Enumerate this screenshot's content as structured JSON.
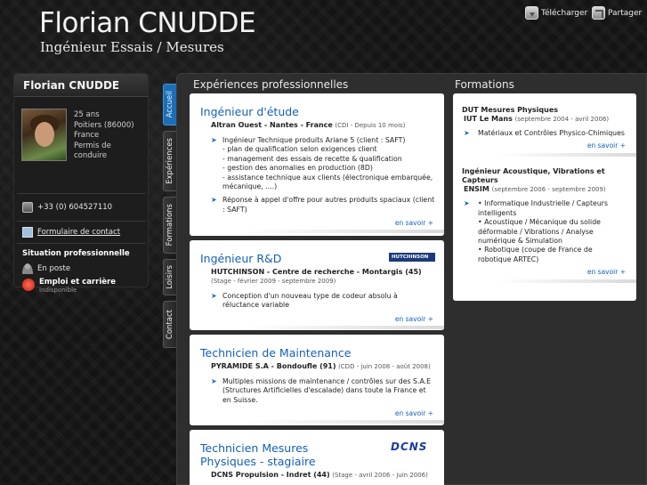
{
  "header": {
    "name": "Florian CNUDDE",
    "title": "Ingénieur Essais / Mesures",
    "download_label": "Télécharger",
    "share_label": "Partager"
  },
  "sidebar": {
    "name": "Florian CNUDDE",
    "profile": {
      "age": "25 ans",
      "city": "Poitiers (86000)",
      "country": "France",
      "license": "Permis de conduire"
    },
    "phone": "+33 (0) 604527110",
    "contact_form": "Formulaire de contact",
    "situation_title": "Situation professionnelle",
    "status": "En poste",
    "job_title": "Emploi et carrière",
    "job_status": "Indisponible"
  },
  "tabs": [
    "Accueil",
    "Expériences",
    "Formations",
    "Loisirs",
    "Contact"
  ],
  "experiences": {
    "title": "Expériences professionnelles",
    "more_label": "en savoir +",
    "items": [
      {
        "role": "Ingénieur d'étude",
        "company": "Altran Ouest - Nantes - France",
        "detail": "(CDI - Depuis 10 mois)",
        "bullets": [
          "Ingénieur Technique produits Ariane 5 (client : SAFT)\n- plan de qualification selon exigences client\n- management des essais de recette & qualification\n- gestion des anomalies en production (8D)\n- assistance technique aux clients (électronique embarquée, mécanique, ....)",
          "Réponse à appel d'offre pour autres produits spaciaux (client : SAFT)"
        ]
      },
      {
        "role": "Ingénieur R&D",
        "logo": "HUTCHINSON",
        "company": "HUTCHINSON - Centre de recherche - Montargis (45)",
        "detail": "(Stage - février 2009 - septembre 2009)",
        "bullets": [
          "Conception d'un nouveau type de codeur absolu à réluctance variable"
        ]
      },
      {
        "role": "Technicien de Maintenance",
        "company": "PYRAMIDE S.A - Bondoufle (91)",
        "detail": "(CDD - juin 2008 - août 2008)",
        "bullets": [
          "Multiples missions de maintenance / contrôles sur des S.A.E (Structures Artificielles d'escalade) dans toute la France et en Suisse."
        ]
      },
      {
        "role": "Technicien Mesures Physiques - stagiaire",
        "logo": "DCNS",
        "company": "DCNS Propulsion - Indret (44)",
        "detail": "(Stage - avril 2006 - juin 2006)"
      }
    ]
  },
  "formations": {
    "title": "Formations",
    "more_label": "en savoir +",
    "items": [
      {
        "degree": "DUT Mesures Physiques",
        "school": "IUT Le Mans",
        "detail": "(septembre 2004 - avril 2006)",
        "bullets": [
          "Matériaux et Contrôles Physico-Chimiques"
        ]
      },
      {
        "degree": "Ingénieur Acoustique, Vibrations et Capteurs",
        "school": "ENSIM",
        "detail": "(septembre 2006 - septembre 2009)",
        "bullets": [
          "• Informatique Industrielle / Capteurs intelligents\n• Acoustique / Mécanique du solide déformable / Vibrations / Analyse numérique & Simulation\n• Robotique (coupe de France de robotique ARTEC)"
        ]
      }
    ]
  }
}
